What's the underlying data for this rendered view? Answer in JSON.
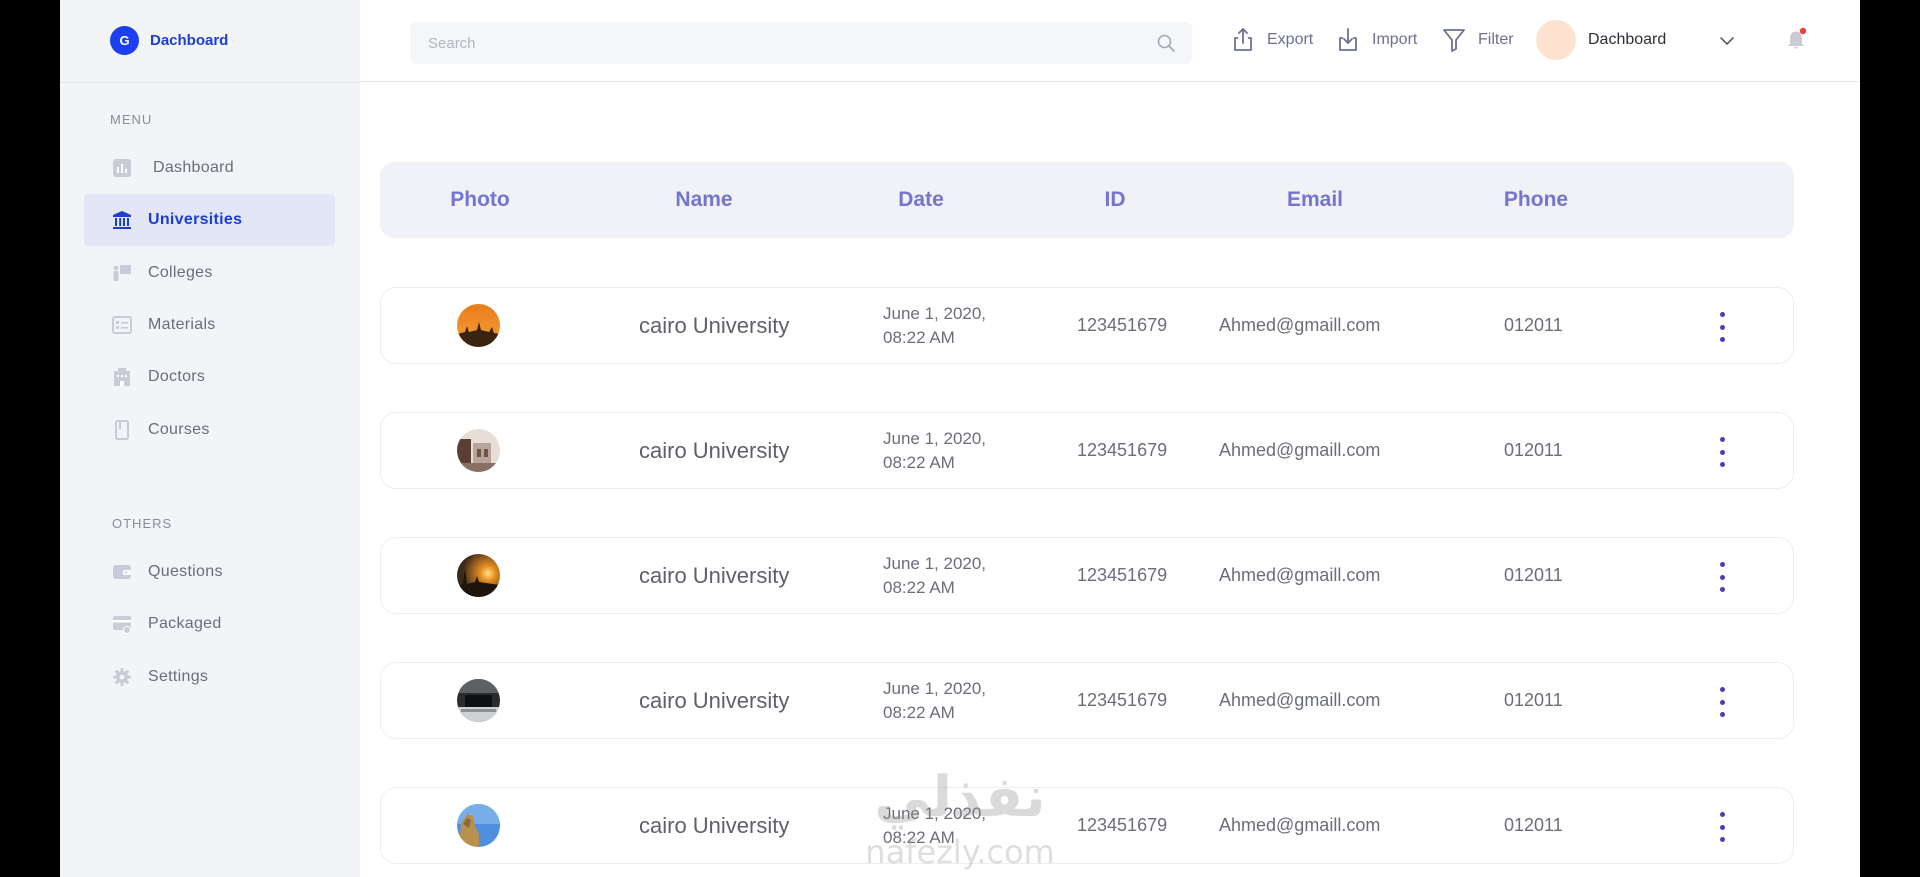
{
  "brand": {
    "logo_letter": "G",
    "name": "Dachboard"
  },
  "sidebar": {
    "menu_label": "MENU",
    "others_label": "OTHERS",
    "items": [
      {
        "label": "Dashboard",
        "icon": "bar-chart-icon"
      },
      {
        "label": "Universities",
        "icon": "institution-icon",
        "active": true
      },
      {
        "label": "Colleges",
        "icon": "presentation-icon"
      },
      {
        "label": "Materials",
        "icon": "list-doc-icon"
      },
      {
        "label": "Doctors",
        "icon": "building-icon"
      },
      {
        "label": "Courses",
        "icon": "book-icon"
      },
      {
        "label": "Questions",
        "icon": "wallet-icon"
      },
      {
        "label": "Packaged",
        "icon": "card-icon"
      },
      {
        "label": "Settings",
        "icon": "gear-icon"
      }
    ]
  },
  "topbar": {
    "search_placeholder": "Search",
    "export_label": "Export",
    "import_label": "Import",
    "filter_label": "Filter",
    "user_name": "Dachboard"
  },
  "table": {
    "headers": [
      "Photo",
      "Name",
      "Date",
      "ID",
      "Email",
      "Phone"
    ],
    "rows": [
      {
        "name": "cairo University",
        "date_line1": "June 1, 2020,",
        "date_line2": "08:22 AM",
        "id": "123451679",
        "email": "Ahmed@gmaill.com",
        "phone": "012011"
      },
      {
        "name": "cairo University",
        "date_line1": "June 1, 2020,",
        "date_line2": "08:22 AM",
        "id": "123451679",
        "email": "Ahmed@gmaill.com",
        "phone": "012011"
      },
      {
        "name": "cairo University",
        "date_line1": "June 1, 2020,",
        "date_line2": "08:22 AM",
        "id": "123451679",
        "email": "Ahmed@gmaill.com",
        "phone": "012011"
      },
      {
        "name": "cairo University",
        "date_line1": "June 1, 2020,",
        "date_line2": "08:22 AM",
        "id": "123451679",
        "email": "Ahmed@gmaill.com",
        "phone": "012011"
      },
      {
        "name": "cairo University",
        "date_line1": "June 1, 2020,",
        "date_line2": "08:22 AM",
        "id": "123451679",
        "email": "Ahmed@gmaill.com",
        "phone": "012011"
      }
    ]
  },
  "watermark": {
    "arabic": "نفذلي",
    "latin": "nafezly.com"
  },
  "colors": {
    "accent": "#1c3fd0",
    "header_text": "#7375d0",
    "more_dots": "#4c3fb0",
    "notification_dot": "#f04040"
  }
}
